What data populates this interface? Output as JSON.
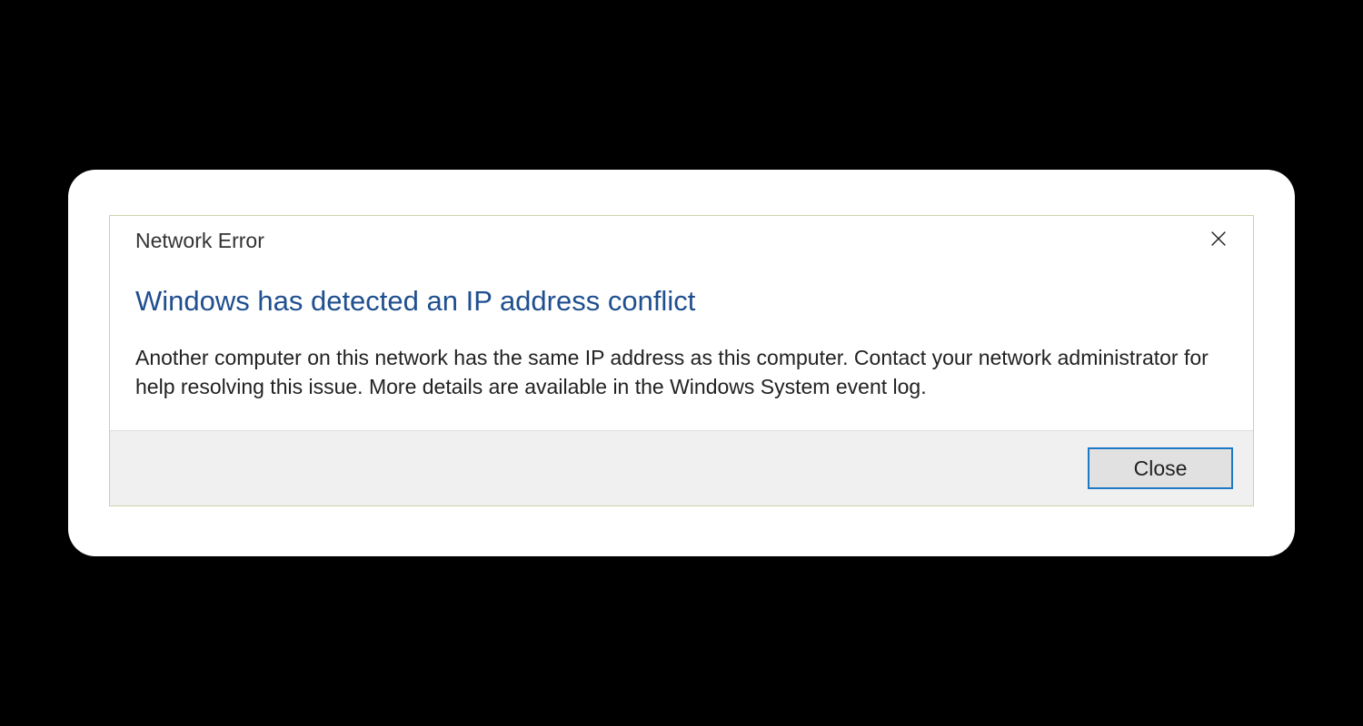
{
  "dialog": {
    "title": "Network Error",
    "headline": "Windows has detected an IP address conflict",
    "body": "Another computer on this network has the same IP address as this computer. Contact your network administrator for help resolving this issue. More details are available in the Windows System event log.",
    "close_button_label": "Close"
  }
}
